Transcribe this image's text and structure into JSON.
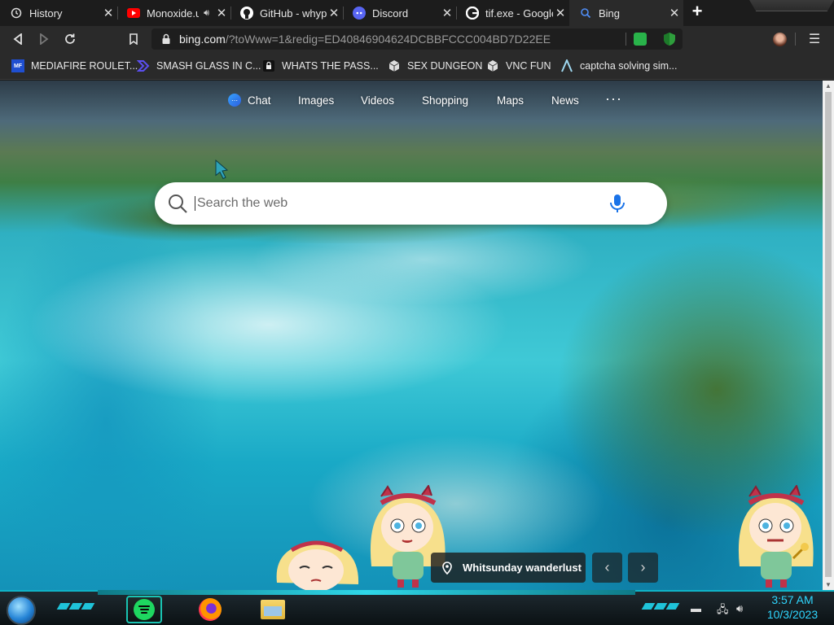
{
  "tabs": [
    {
      "title": "History",
      "icon": "history-icon",
      "active": false
    },
    {
      "title": "Monoxide.u",
      "icon": "youtube-icon",
      "active": false
    },
    {
      "title": "GitHub - whypo",
      "icon": "github-icon",
      "active": false
    },
    {
      "title": "Discord",
      "icon": "discord-icon",
      "active": false
    },
    {
      "title": "tif.exe - Google",
      "icon": "google-icon",
      "active": false
    },
    {
      "title": "Bing",
      "icon": "bing-search-icon",
      "active": true
    }
  ],
  "toolbar": {
    "url_host": "bing.com",
    "url_path": "/?toWww=1&redig=ED40846904624DCBBFCCC004BD7D22EE"
  },
  "bookmarks": [
    {
      "label": "MEDIAFIRE ROULET...",
      "icon": "mediafire-icon"
    },
    {
      "label": "SMASH GLASS IN C...",
      "icon": "chevron-logo-icon"
    },
    {
      "label": "WHATS THE PASS...",
      "icon": "lock-icon"
    },
    {
      "label": "SEX DUNGEON",
      "icon": "cube-icon"
    },
    {
      "label": "VNC FUN",
      "icon": "cube-icon"
    },
    {
      "label": "captcha solving sim...",
      "icon": "a-logo-icon"
    }
  ],
  "bing": {
    "nav": [
      "Chat",
      "Images",
      "Videos",
      "Shopping",
      "Maps",
      "News"
    ],
    "more": "···",
    "search_placeholder": "Search the web",
    "caption": "Whitsunday wanderlust"
  },
  "taskbar": {
    "time": "3:57 AM",
    "date": "10/3/2023",
    "apps": [
      "spotify-icon",
      "firefox-icon",
      "file-explorer-icon"
    ]
  },
  "colors": {
    "accent_tab_text": "#8ab4f8",
    "taskbar_accent": "#0fb4c8",
    "clock": "#2fd7ff"
  }
}
